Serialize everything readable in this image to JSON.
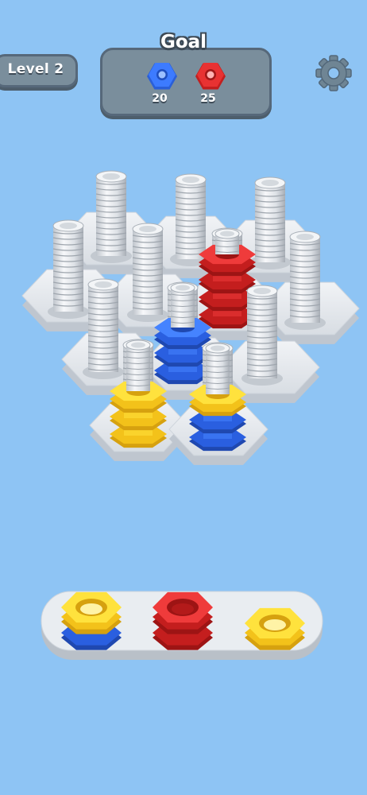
{
  "hud": {
    "level_label": "Level 2",
    "settings_icon": "gear-icon"
  },
  "goal": {
    "title": "Goal",
    "items": [
      {
        "color_name": "blue",
        "color": "#2f6bf0",
        "icon": "blue-nut-icon",
        "count": "20"
      },
      {
        "color_name": "red",
        "color": "#e12b2b",
        "icon": "red-nut-icon",
        "count": "25"
      }
    ]
  },
  "colors": {
    "background": "#8ec4f4",
    "panel": "#7a8e9c",
    "board": "#e6ebf1",
    "bolt": "#e3e7ec",
    "red": "#e12b2b",
    "blue": "#2f6bf0",
    "yellow": "#fbd92a"
  },
  "board": {
    "bolts": [
      {
        "id": "bolt-back-1",
        "nuts": []
      },
      {
        "id": "bolt-back-2",
        "nuts": []
      },
      {
        "id": "bolt-back-3",
        "nuts": []
      },
      {
        "id": "bolt-mid-left",
        "nuts": []
      },
      {
        "id": "bolt-mid-center",
        "nuts": []
      },
      {
        "id": "bolt-red-stack",
        "nuts": [
          "red",
          "red",
          "red",
          "red"
        ]
      },
      {
        "id": "bolt-mid-right",
        "nuts": []
      },
      {
        "id": "bolt-front-left",
        "nuts": []
      },
      {
        "id": "bolt-blue-stack",
        "nuts": [
          "blue",
          "blue",
          "blue"
        ]
      },
      {
        "id": "bolt-front-right",
        "nuts": []
      },
      {
        "id": "bolt-yellow-stack",
        "nuts": [
          "yellow",
          "yellow",
          "yellow"
        ]
      },
      {
        "id": "bolt-mixed-stack",
        "nuts": [
          "blue",
          "blue",
          "yellow"
        ]
      }
    ]
  },
  "tray": {
    "slots": [
      {
        "id": "tray-slot-1",
        "nuts": [
          "blue",
          "yellow"
        ]
      },
      {
        "id": "tray-slot-2",
        "nuts": [
          "red",
          "red"
        ]
      },
      {
        "id": "tray-slot-3",
        "nuts": [
          "yellow"
        ]
      }
    ]
  }
}
